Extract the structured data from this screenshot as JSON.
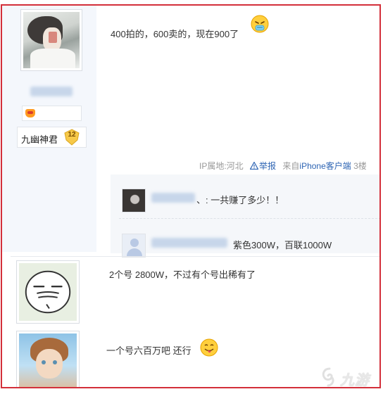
{
  "posts": [
    {
      "author_level": {
        "name": "九幽神君",
        "number": "12"
      },
      "text": "400拍的，600卖的，现在900了",
      "emoji": "sick-face-emoji",
      "meta": {
        "ip": "IP属地:河北",
        "report": "举报",
        "device_prefix": "来自",
        "device_name": "iPhone客户端",
        "floor": "3楼"
      },
      "replies": [
        {
          "user_suffix": "、",
          "text": ": 一共赚了多少！！"
        },
        {
          "user_prefix": "贴吧用户_",
          "user_masked": "9SQi7Y2",
          "text": "紫色300W，百联1000W"
        }
      ]
    },
    {
      "text": "2个号 2800W，不过有个号出稀有了"
    },
    {
      "text": "一个号六百万吧 还行",
      "emoji": "tongue-out-emoji"
    }
  ],
  "watermark": {
    "text": "九游"
  },
  "colors": {
    "border": "#d32f3a",
    "link": "#2d64b3",
    "sidebar": "#f4f7fc",
    "reply_bg": "#f5f7fa"
  }
}
